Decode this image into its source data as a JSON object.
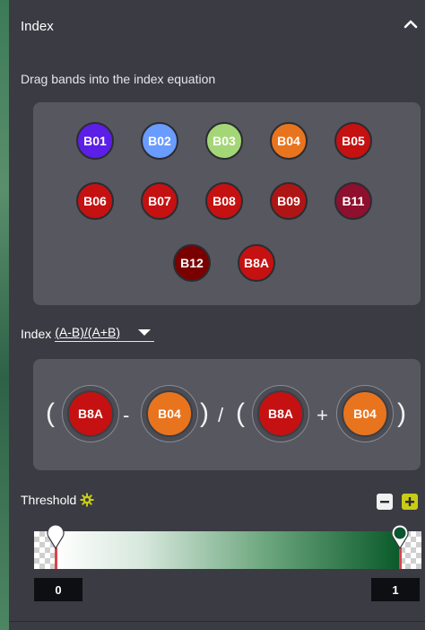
{
  "header": {
    "title": "Index"
  },
  "subtitle": "Drag bands into the index equation",
  "bands": [
    {
      "label": "B01",
      "color": "#5b1fe8"
    },
    {
      "label": "B02",
      "color": "#6a9cff"
    },
    {
      "label": "B03",
      "color": "#a4d677"
    },
    {
      "label": "B04",
      "color": "#e9741e"
    },
    {
      "label": "B05",
      "color": "#c51111"
    },
    {
      "label": "B06",
      "color": "#c51111"
    },
    {
      "label": "B07",
      "color": "#c51111"
    },
    {
      "label": "B08",
      "color": "#c51111"
    },
    {
      "label": "B09",
      "color": "#b01515"
    },
    {
      "label": "B11",
      "color": "#8e0f2e"
    },
    {
      "label": "B12",
      "color": "#7a0000"
    },
    {
      "label": "B8A",
      "color": "#c51111"
    }
  ],
  "index": {
    "label": "Index",
    "selected": "(A-B)/(A+B)"
  },
  "equation": {
    "open1": "(",
    "close1": ")",
    "open2": "(",
    "close2": ")",
    "minus": "-",
    "divide": "/",
    "plus": "+",
    "a1": {
      "label": "B8A",
      "color": "#c51111"
    },
    "b1": {
      "label": "B04",
      "color": "#e9741e"
    },
    "a2": {
      "label": "B8A",
      "color": "#c51111"
    },
    "b2": {
      "label": "B04",
      "color": "#e9741e"
    }
  },
  "threshold": {
    "label": "Threshold",
    "min_value": "0",
    "max_value": "1",
    "low_handle_fraction": 0.0,
    "high_handle_fraction": 1.0,
    "gear_color": "#c8cc16",
    "icons": {
      "settings": "gear-icon",
      "zoom_out": "minus-icon",
      "zoom_in": "plus-icon"
    }
  },
  "icons": {
    "collapse": "chevron-up-icon"
  }
}
